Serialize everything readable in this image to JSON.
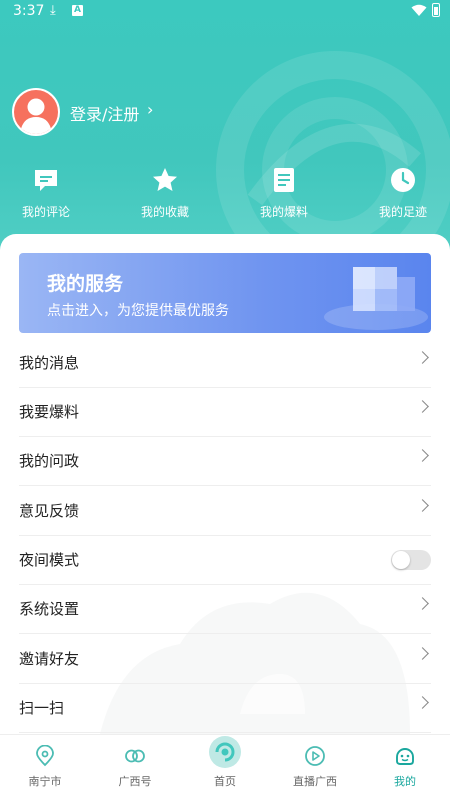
{
  "status_bar": {
    "time": "3:37"
  },
  "profile": {
    "login_label": "登录/注册",
    "chevron": "›"
  },
  "quick_actions": [
    {
      "label": "我的评论",
      "icon": "comment-icon"
    },
    {
      "label": "我的收藏",
      "icon": "star-icon"
    },
    {
      "label": "我的爆料",
      "icon": "document-icon"
    },
    {
      "label": "我的足迹",
      "icon": "clock-icon"
    }
  ],
  "service_banner": {
    "title": "我的服务",
    "subtitle": "点击进入，为您提供最优服务"
  },
  "menu": [
    {
      "label": "我的消息"
    },
    {
      "label": "我要爆料"
    },
    {
      "label": "我的问政"
    },
    {
      "label": "意见反馈"
    },
    {
      "label": "夜间模式",
      "toggle": false
    },
    {
      "label": "系统设置"
    },
    {
      "label": "邀请好友"
    },
    {
      "label": "扫一扫"
    }
  ],
  "tab_bar": [
    {
      "label": "南宁市",
      "icon": "location-icon"
    },
    {
      "label": "广西号",
      "icon": "link-icon"
    },
    {
      "label": "首页",
      "icon": "home-logo-icon"
    },
    {
      "label": "直播广西",
      "icon": "play-icon"
    },
    {
      "label": "我的",
      "icon": "profile-icon",
      "active": true
    }
  ],
  "colors": {
    "accent": "#41c7bd",
    "active_tab": "#1aa79e",
    "avatar": "#f6715e",
    "banner": "#6f94f0"
  }
}
